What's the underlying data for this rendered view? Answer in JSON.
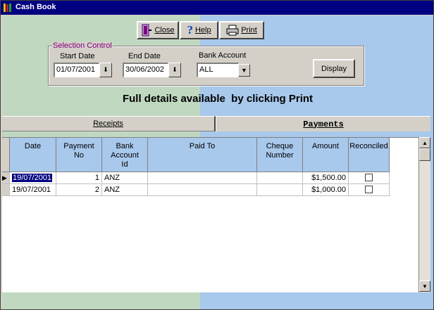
{
  "window": {
    "title": "Cash Book",
    "icon": "books-icon"
  },
  "toolbar": {
    "close_label": "Close",
    "close_icon": "door-exit-icon",
    "help_label": "Help",
    "help_icon": "question-mark-icon",
    "print_label": "Print",
    "print_icon": "printer-icon"
  },
  "selection": {
    "group_title": "Selection Control",
    "start_date_label": "Start Date",
    "start_date_value": "01/07/2001",
    "end_date_label": "End Date",
    "end_date_value": "30/06/2002",
    "bank_account_label": "Bank Account",
    "bank_account_value": "ALL",
    "display_label": "Display"
  },
  "info_text": "Full details available  by clicking Print",
  "tabs": [
    {
      "label": "Receipts",
      "active": false
    },
    {
      "label": "Payments",
      "active": true
    }
  ],
  "grid": {
    "headers": {
      "date": "Date",
      "payment_no_1": "Payment",
      "payment_no_2": "No",
      "bank_1": "Bank",
      "bank_2": "Account",
      "bank_3": "Id",
      "paid_to": "Paid To",
      "cheque_1": "Cheque",
      "cheque_2": "Number",
      "amount": "Amount",
      "reconciled": "Reconciled"
    },
    "rows": [
      {
        "date": "19/07/2001",
        "payment_no": "1",
        "bank": "ANZ",
        "paid_to": "",
        "cheque": "",
        "amount": "$1,500.00",
        "reconciled": false
      },
      {
        "date": "19/07/2001",
        "payment_no": "2",
        "bank": "ANZ",
        "paid_to": "",
        "cheque": "",
        "amount": "$1,000.00",
        "reconciled": false
      }
    ]
  },
  "colors": {
    "title_bar": "#000080",
    "left_panel": "#c0d8c0",
    "right_panel": "#a8c8ec",
    "header_bg": "#a8c8ec",
    "group_title": "#800080"
  }
}
